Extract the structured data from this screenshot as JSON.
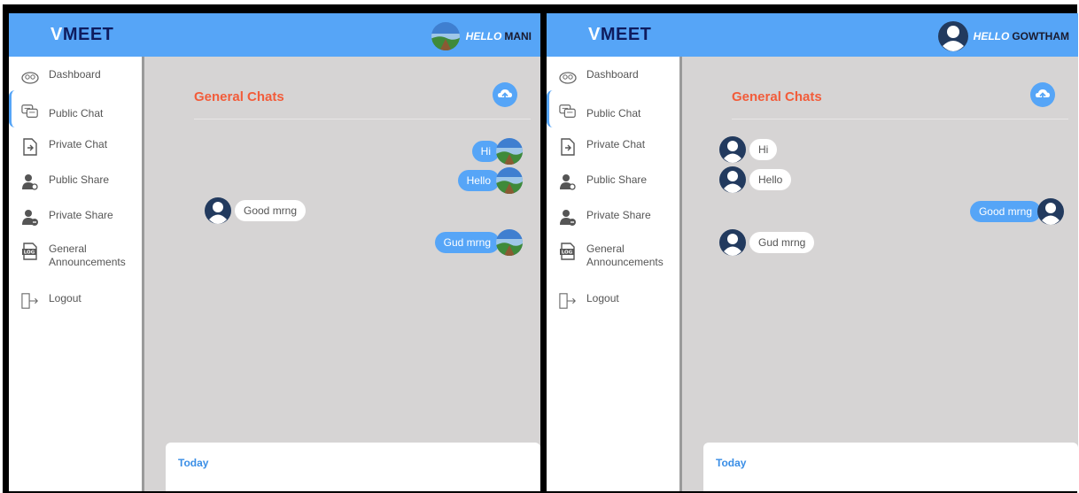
{
  "panels": [
    {
      "logo": {
        "v": "V",
        "rest": "MEET"
      },
      "greeting": {
        "hello": "HELLO",
        "user": "MANI"
      },
      "nav": [
        {
          "label": "Dashboard",
          "icon": "dashboard-icon"
        },
        {
          "label": "Public Chat",
          "icon": "chat-icon"
        },
        {
          "label": "Private Chat",
          "icon": "private-chat-icon"
        },
        {
          "label": "Public Share",
          "icon": "public-share-icon"
        },
        {
          "label": "Private Share",
          "icon": "private-share-icon"
        },
        {
          "label": "General\nAnnouncements",
          "icon": "log-icon"
        },
        {
          "label": "Logout",
          "icon": "logout-icon"
        }
      ],
      "chat_title": "General Chats",
      "messages": [
        {
          "text": "Hi",
          "side": "right"
        },
        {
          "text": "Hello",
          "side": "right"
        },
        {
          "text": "Good mrng",
          "side": "left"
        },
        {
          "text": "Gud mrng",
          "side": "right"
        }
      ],
      "composer_label": "Today"
    },
    {
      "logo": {
        "v": "V",
        "rest": "MEET"
      },
      "greeting": {
        "hello": "HELLO",
        "user": "GOWTHAM"
      },
      "nav": [
        {
          "label": "Dashboard",
          "icon": "dashboard-icon"
        },
        {
          "label": "Public Chat",
          "icon": "chat-icon"
        },
        {
          "label": "Private Chat",
          "icon": "private-chat-icon"
        },
        {
          "label": "Public Share",
          "icon": "public-share-icon"
        },
        {
          "label": "Private Share",
          "icon": "private-share-icon"
        },
        {
          "label": "General\nAnnouncements",
          "icon": "log-icon"
        },
        {
          "label": "Logout",
          "icon": "logout-icon"
        }
      ],
      "chat_title": "General Chats",
      "messages": [
        {
          "text": "Hi",
          "side": "left"
        },
        {
          "text": "Hello",
          "side": "left"
        },
        {
          "text": "Good mrng",
          "side": "right"
        },
        {
          "text": "Gud mrng",
          "side": "left"
        }
      ],
      "composer_label": "Today"
    }
  ],
  "colors": {
    "header": "#56a5f7",
    "accent": "#f25c3a",
    "chat_bg": "#d6d4d4"
  }
}
